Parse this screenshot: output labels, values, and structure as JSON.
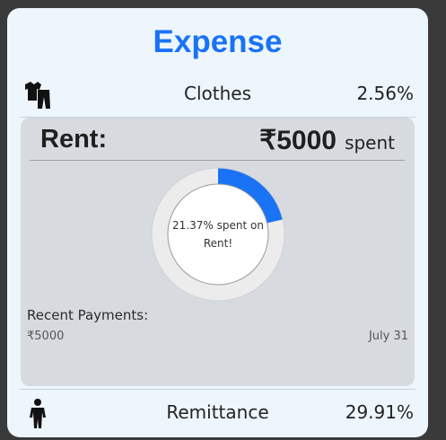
{
  "title": "Expense",
  "top_row": {
    "icon": "clothes-icon",
    "label": "Clothes",
    "percent": "2.56%"
  },
  "card": {
    "title": "Rent:",
    "amount": "₹5000",
    "amount_suffix": "spent",
    "donut": {
      "fraction": 0.2137,
      "fill_color": "#1a73f5",
      "track_color": "#ececec",
      "caption_line1": "21.37% spent on",
      "caption_line2": "Rent!"
    },
    "recent_heading": "Recent Payments:",
    "payments": [
      {
        "amount": "₹5000",
        "date": "July 31"
      }
    ]
  },
  "bottom_row": {
    "icon": "person-icon",
    "label": "Remittance",
    "percent": "29.91%"
  },
  "colors": {
    "accent": "#1a73f5",
    "panel_bg": "#eef6fd",
    "card_bg": "#d7dbe0"
  }
}
